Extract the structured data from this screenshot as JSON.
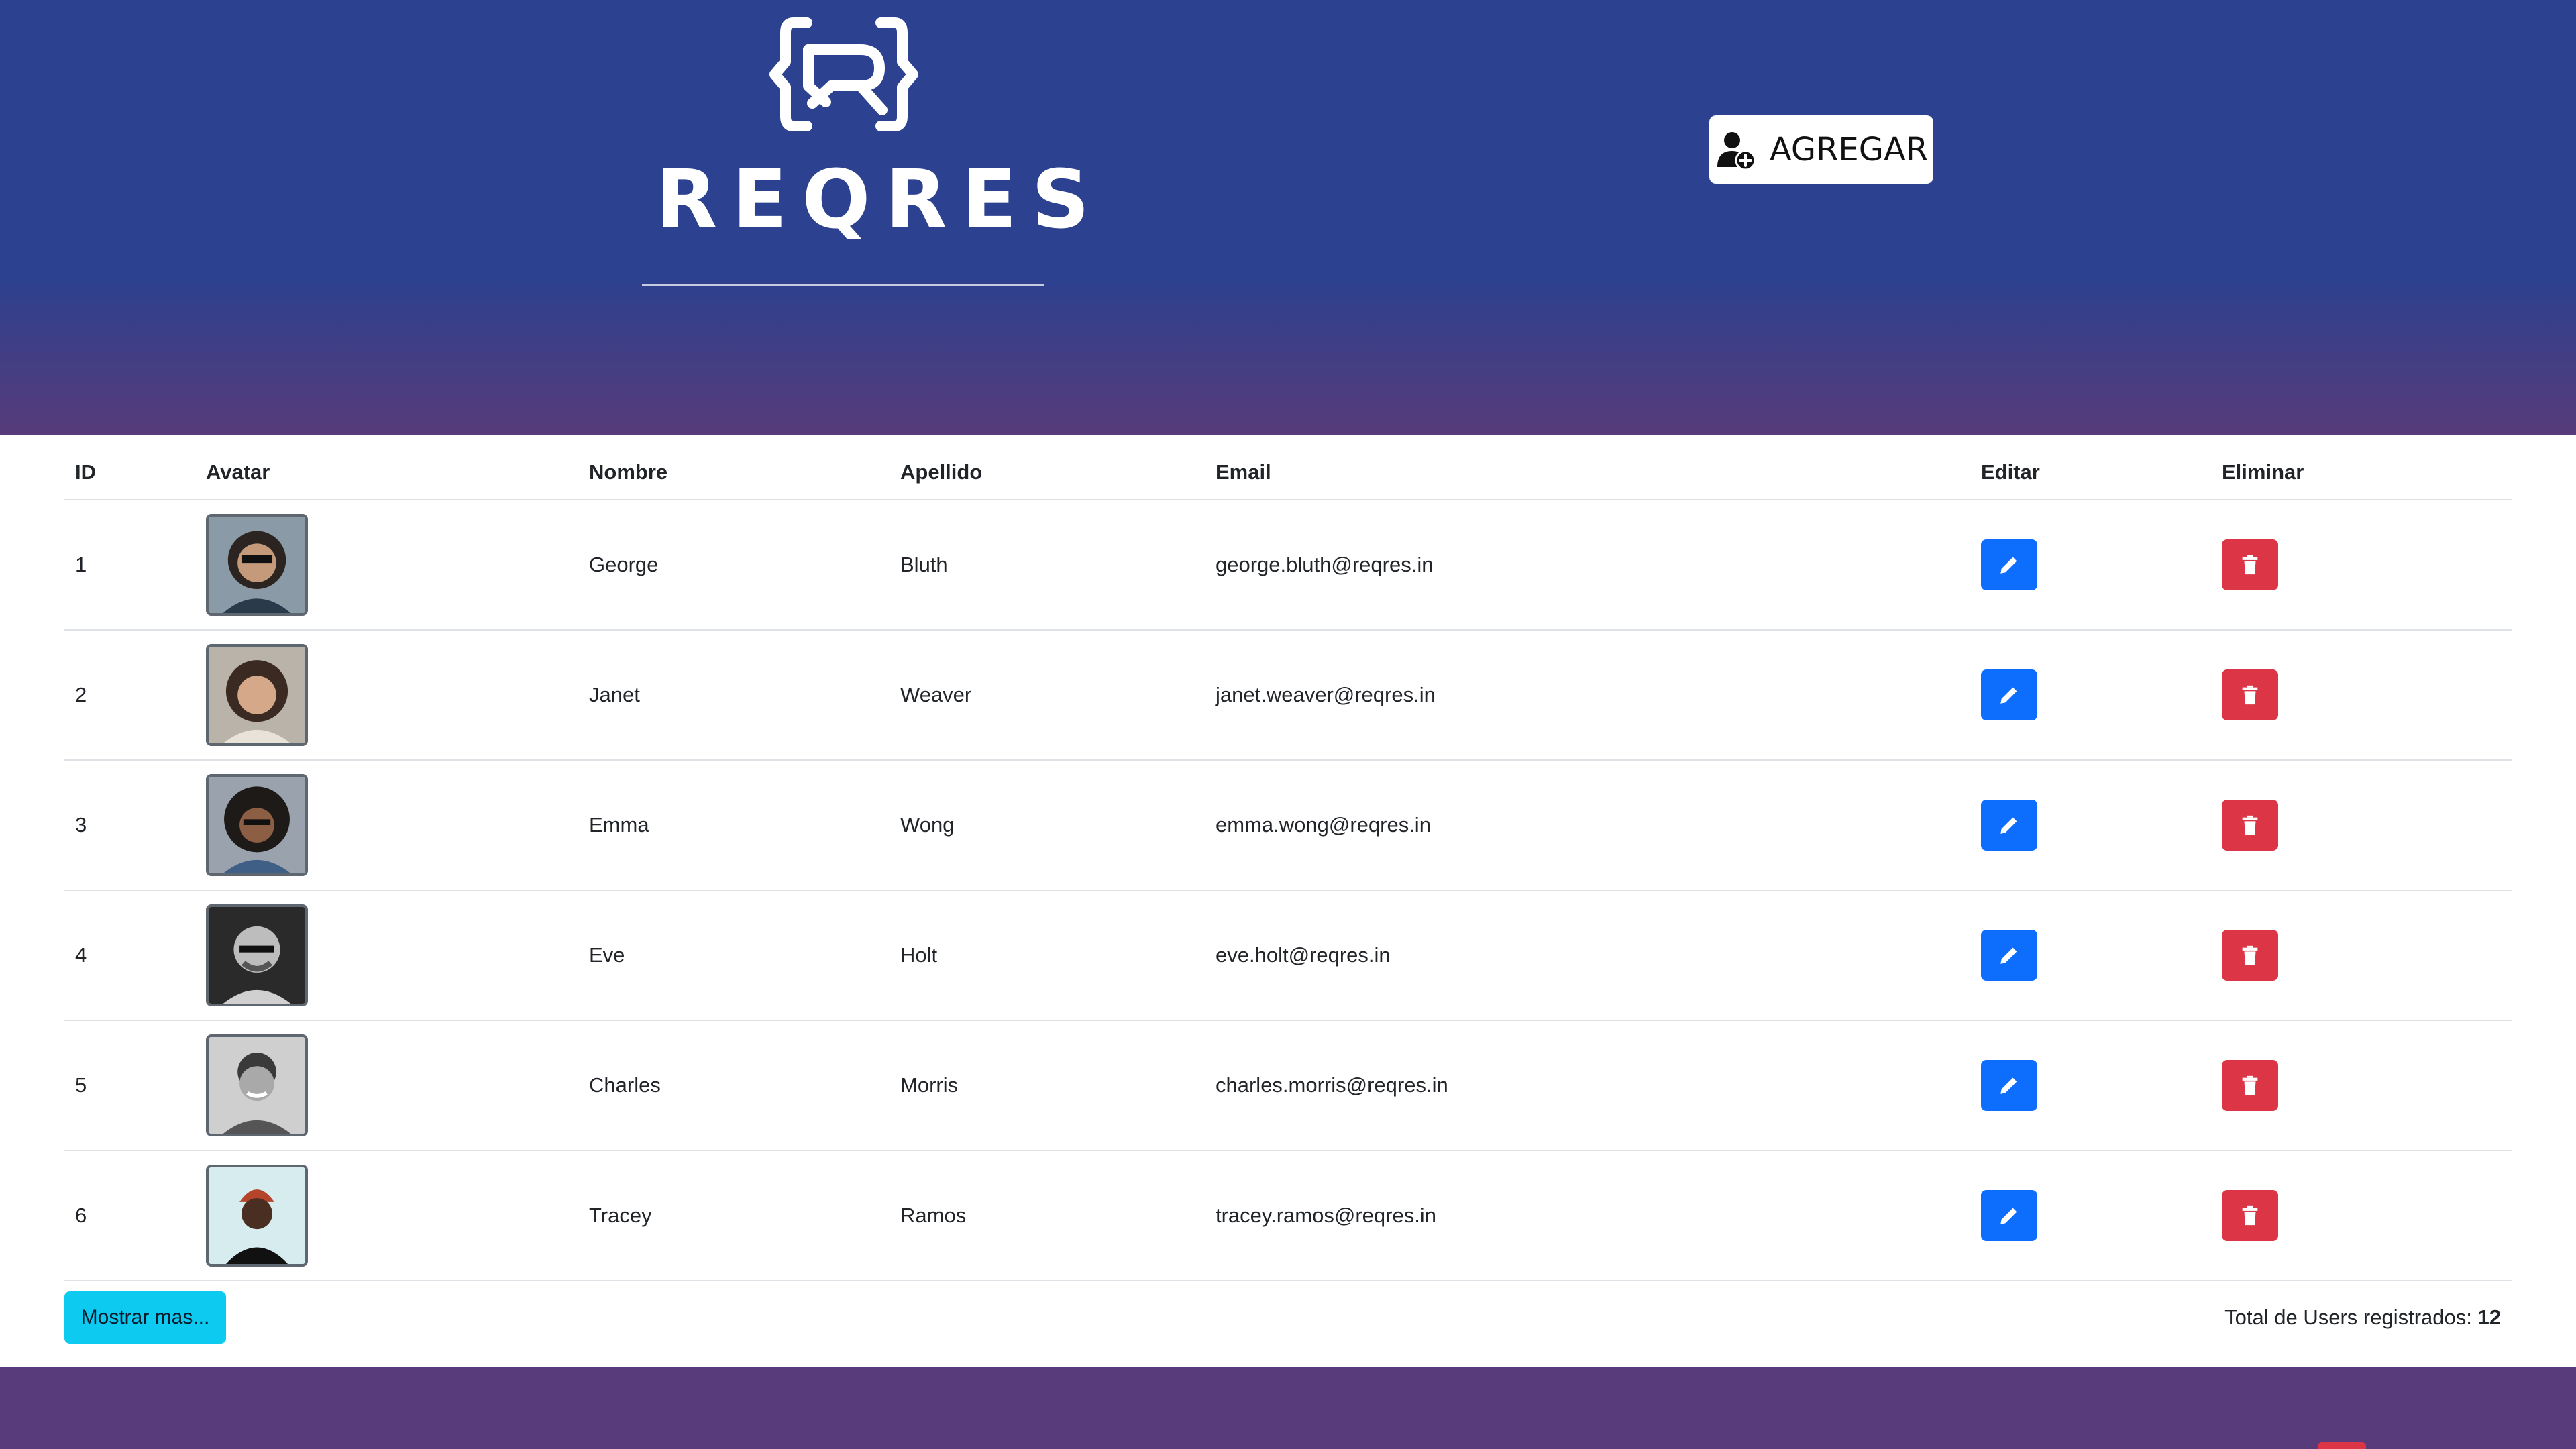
{
  "header": {
    "logo_text": "REQRES",
    "add_button_label": "AGREGAR"
  },
  "table": {
    "columns": [
      "ID",
      "Avatar",
      "Nombre",
      "Apellido",
      "Email",
      "Editar",
      "Eliminar"
    ],
    "rows": [
      {
        "id": "1",
        "first_name": "George",
        "last_name": "Bluth",
        "email": "george.bluth@reqres.in"
      },
      {
        "id": "2",
        "first_name": "Janet",
        "last_name": "Weaver",
        "email": "janet.weaver@reqres.in"
      },
      {
        "id": "3",
        "first_name": "Emma",
        "last_name": "Wong",
        "email": "emma.wong@reqres.in"
      },
      {
        "id": "4",
        "first_name": "Eve",
        "last_name": "Holt",
        "email": "eve.holt@reqres.in"
      },
      {
        "id": "5",
        "first_name": "Charles",
        "last_name": "Morris",
        "email": "charles.morris@reqres.in"
      },
      {
        "id": "6",
        "first_name": "Tracey",
        "last_name": "Ramos",
        "email": "tracey.ramos@reqres.in"
      }
    ]
  },
  "footer_bar": {
    "show_more_label": "Mostrar mas...",
    "total_label": "Total de Users registrados:",
    "total_value": "12"
  },
  "icons": {
    "add_user": "user-plus-icon",
    "edit": "pencil-icon",
    "delete": "trash-icon"
  },
  "colors": {
    "header_top": "#2c418f",
    "header_bottom": "#573b7a",
    "edit": "#0d6efd",
    "delete": "#dc3545",
    "show_more": "#0dcaf0"
  }
}
